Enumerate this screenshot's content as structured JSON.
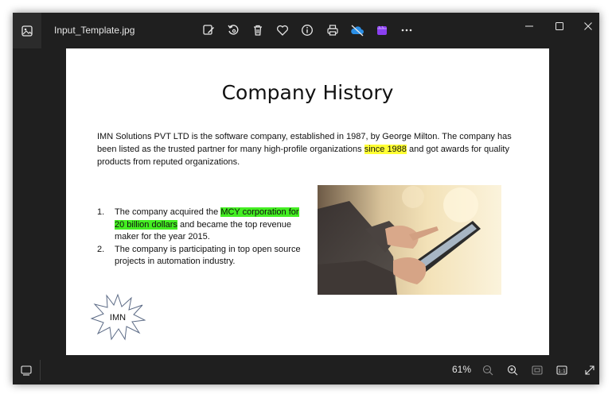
{
  "window": {
    "filename": "Input_Template.jpg",
    "toolbar_icons": [
      "edit-image-icon",
      "rotate-icon",
      "delete-icon",
      "favorite-icon",
      "info-icon",
      "print-icon",
      "onedrive-icon",
      "clipchamp-icon",
      "more-icon"
    ],
    "window_controls": [
      "minimize-icon",
      "maximize-icon",
      "close-icon"
    ]
  },
  "document": {
    "title": "Company History",
    "para_part1": "IMN Solutions PVT LTD is the software company, established in 1987, by George Milton. The company has been listed as the trusted partner for many high-profile organizations ",
    "para_highlight": "since 1988",
    "para_part2": " and got awards for quality products from reputed organizations.",
    "list": [
      {
        "num": "1.",
        "part1": "The company acquired the ",
        "highlight": "MCY corporation for 20 billion dollars",
        "part2": " and became the top revenue maker for the year 2015."
      },
      {
        "num": "2.",
        "text": "The company is participating in top open source projects in automation industry."
      }
    ],
    "starburst_label": "IMN",
    "highlight_colors": {
      "yellow": "#ffff33",
      "green": "#44ee22"
    }
  },
  "statusbar": {
    "zoom": "61%",
    "icons": [
      "filmstrip-icon",
      "zoom-out-icon",
      "zoom-in-icon",
      "fit-to-window-icon",
      "actual-size-icon",
      "fullscreen-icon"
    ]
  }
}
